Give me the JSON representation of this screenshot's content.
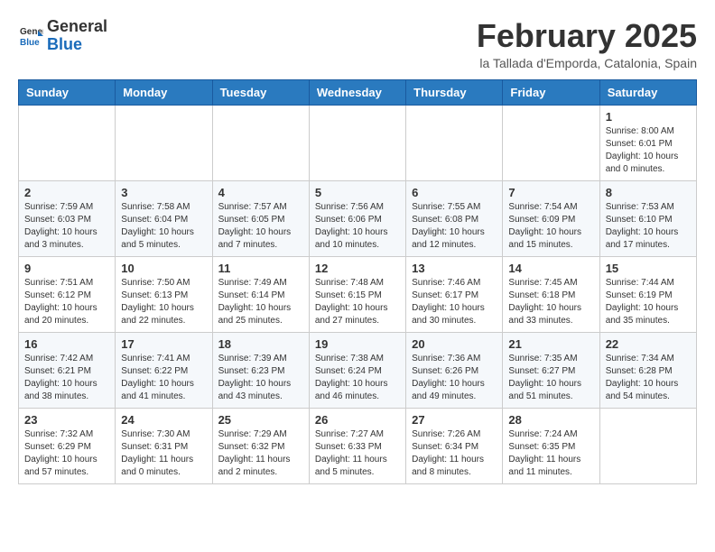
{
  "header": {
    "logo_line1": "General",
    "logo_line2": "Blue",
    "month_year": "February 2025",
    "location": "la Tallada d'Emporda, Catalonia, Spain"
  },
  "weekdays": [
    "Sunday",
    "Monday",
    "Tuesday",
    "Wednesday",
    "Thursday",
    "Friday",
    "Saturday"
  ],
  "weeks": [
    [
      {
        "day": "",
        "info": ""
      },
      {
        "day": "",
        "info": ""
      },
      {
        "day": "",
        "info": ""
      },
      {
        "day": "",
        "info": ""
      },
      {
        "day": "",
        "info": ""
      },
      {
        "day": "",
        "info": ""
      },
      {
        "day": "1",
        "info": "Sunrise: 8:00 AM\nSunset: 6:01 PM\nDaylight: 10 hours\nand 0 minutes."
      }
    ],
    [
      {
        "day": "2",
        "info": "Sunrise: 7:59 AM\nSunset: 6:03 PM\nDaylight: 10 hours\nand 3 minutes."
      },
      {
        "day": "3",
        "info": "Sunrise: 7:58 AM\nSunset: 6:04 PM\nDaylight: 10 hours\nand 5 minutes."
      },
      {
        "day": "4",
        "info": "Sunrise: 7:57 AM\nSunset: 6:05 PM\nDaylight: 10 hours\nand 7 minutes."
      },
      {
        "day": "5",
        "info": "Sunrise: 7:56 AM\nSunset: 6:06 PM\nDaylight: 10 hours\nand 10 minutes."
      },
      {
        "day": "6",
        "info": "Sunrise: 7:55 AM\nSunset: 6:08 PM\nDaylight: 10 hours\nand 12 minutes."
      },
      {
        "day": "7",
        "info": "Sunrise: 7:54 AM\nSunset: 6:09 PM\nDaylight: 10 hours\nand 15 minutes."
      },
      {
        "day": "8",
        "info": "Sunrise: 7:53 AM\nSunset: 6:10 PM\nDaylight: 10 hours\nand 17 minutes."
      }
    ],
    [
      {
        "day": "9",
        "info": "Sunrise: 7:51 AM\nSunset: 6:12 PM\nDaylight: 10 hours\nand 20 minutes."
      },
      {
        "day": "10",
        "info": "Sunrise: 7:50 AM\nSunset: 6:13 PM\nDaylight: 10 hours\nand 22 minutes."
      },
      {
        "day": "11",
        "info": "Sunrise: 7:49 AM\nSunset: 6:14 PM\nDaylight: 10 hours\nand 25 minutes."
      },
      {
        "day": "12",
        "info": "Sunrise: 7:48 AM\nSunset: 6:15 PM\nDaylight: 10 hours\nand 27 minutes."
      },
      {
        "day": "13",
        "info": "Sunrise: 7:46 AM\nSunset: 6:17 PM\nDaylight: 10 hours\nand 30 minutes."
      },
      {
        "day": "14",
        "info": "Sunrise: 7:45 AM\nSunset: 6:18 PM\nDaylight: 10 hours\nand 33 minutes."
      },
      {
        "day": "15",
        "info": "Sunrise: 7:44 AM\nSunset: 6:19 PM\nDaylight: 10 hours\nand 35 minutes."
      }
    ],
    [
      {
        "day": "16",
        "info": "Sunrise: 7:42 AM\nSunset: 6:21 PM\nDaylight: 10 hours\nand 38 minutes."
      },
      {
        "day": "17",
        "info": "Sunrise: 7:41 AM\nSunset: 6:22 PM\nDaylight: 10 hours\nand 41 minutes."
      },
      {
        "day": "18",
        "info": "Sunrise: 7:39 AM\nSunset: 6:23 PM\nDaylight: 10 hours\nand 43 minutes."
      },
      {
        "day": "19",
        "info": "Sunrise: 7:38 AM\nSunset: 6:24 PM\nDaylight: 10 hours\nand 46 minutes."
      },
      {
        "day": "20",
        "info": "Sunrise: 7:36 AM\nSunset: 6:26 PM\nDaylight: 10 hours\nand 49 minutes."
      },
      {
        "day": "21",
        "info": "Sunrise: 7:35 AM\nSunset: 6:27 PM\nDaylight: 10 hours\nand 51 minutes."
      },
      {
        "day": "22",
        "info": "Sunrise: 7:34 AM\nSunset: 6:28 PM\nDaylight: 10 hours\nand 54 minutes."
      }
    ],
    [
      {
        "day": "23",
        "info": "Sunrise: 7:32 AM\nSunset: 6:29 PM\nDaylight: 10 hours\nand 57 minutes."
      },
      {
        "day": "24",
        "info": "Sunrise: 7:30 AM\nSunset: 6:31 PM\nDaylight: 11 hours\nand 0 minutes."
      },
      {
        "day": "25",
        "info": "Sunrise: 7:29 AM\nSunset: 6:32 PM\nDaylight: 11 hours\nand 2 minutes."
      },
      {
        "day": "26",
        "info": "Sunrise: 7:27 AM\nSunset: 6:33 PM\nDaylight: 11 hours\nand 5 minutes."
      },
      {
        "day": "27",
        "info": "Sunrise: 7:26 AM\nSunset: 6:34 PM\nDaylight: 11 hours\nand 8 minutes."
      },
      {
        "day": "28",
        "info": "Sunrise: 7:24 AM\nSunset: 6:35 PM\nDaylight: 11 hours\nand 11 minutes."
      },
      {
        "day": "",
        "info": ""
      }
    ]
  ]
}
